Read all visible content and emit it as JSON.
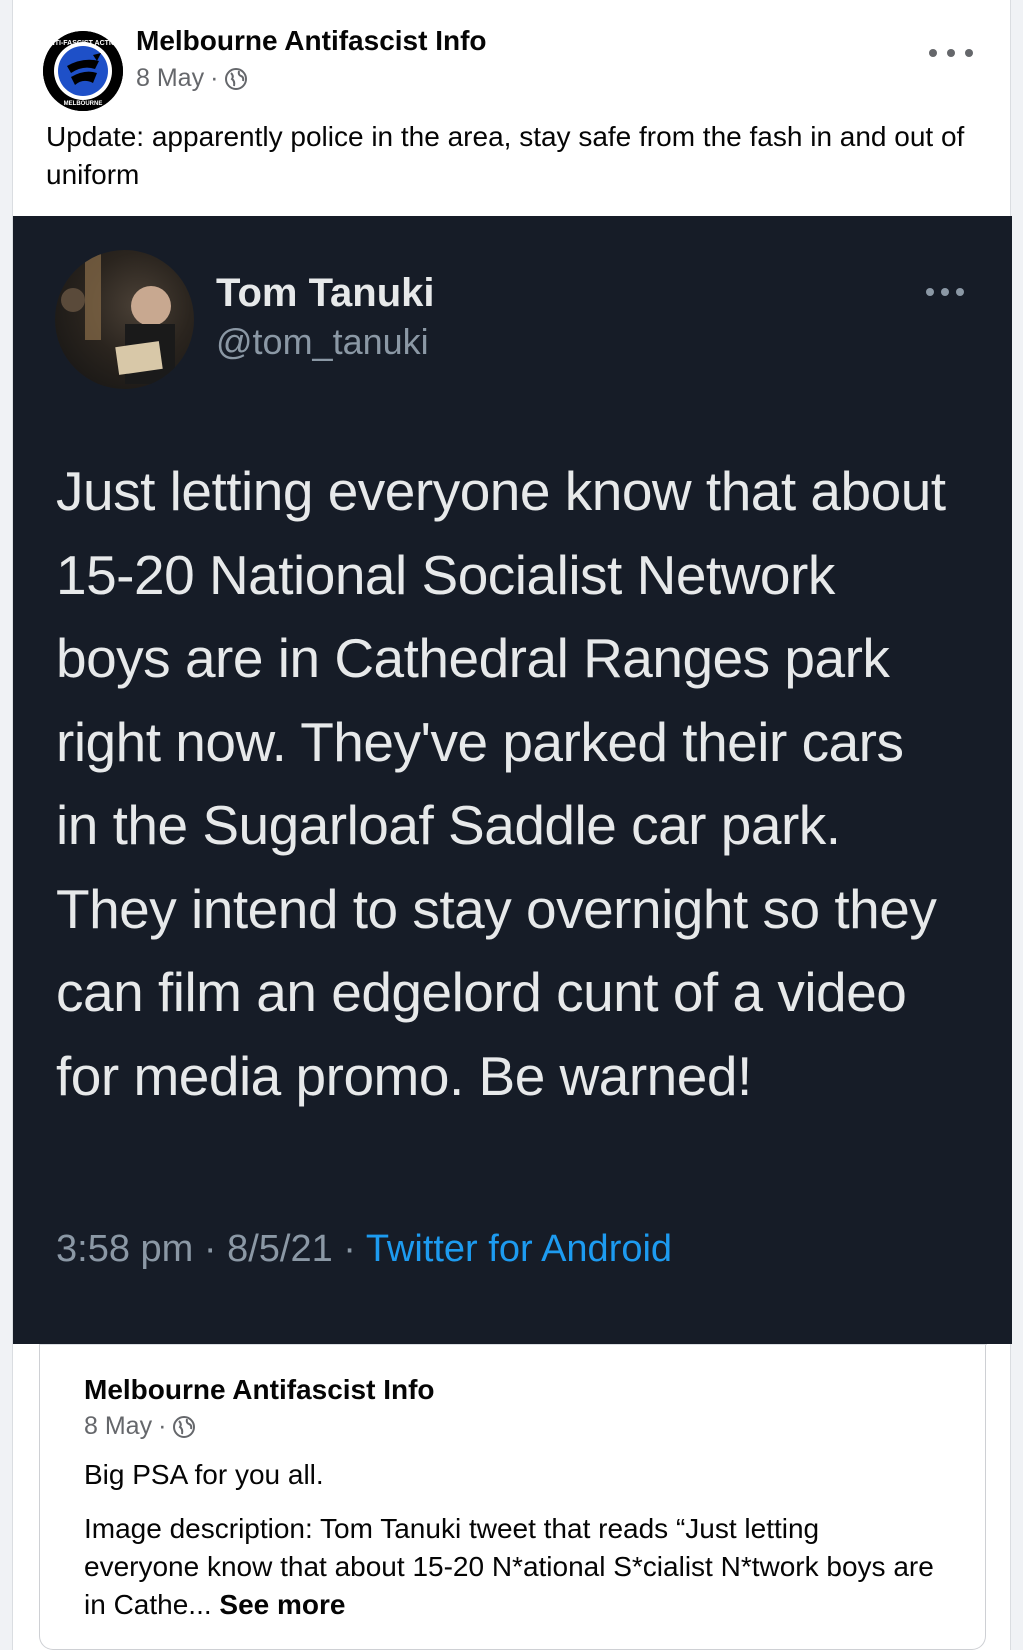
{
  "post": {
    "author": "Melbourne Antifascist Info",
    "date": "8 May",
    "separator": "·",
    "text": "Update: apparently police in the area, stay safe from the fash in and out of uniform",
    "logo_text_top": "ANTI-FASCIST ACTION",
    "logo_text_bottom": "MELBOURNE"
  },
  "tweet": {
    "name": "Tom Tanuki",
    "handle": "@tom_tanuki",
    "body": "Just letting everyone know that about 15-20 National Socialist Network boys are in Cathedral Ranges park right now. They've parked their cars in the Sugarloaf Saddle car park. They intend to stay overnight so they can film an edgelord cunt of a video for media promo. Be warned!",
    "time": "3:58 pm · 8/5/21 · ",
    "source": "Twitter for Android"
  },
  "shared": {
    "author": "Melbourne Antifascist Info",
    "date": "8 May",
    "separator": "·",
    "text1": "Big PSA for you all.",
    "text2": "Image description: Tom Tanuki tweet that reads “Just letting everyone know that about 15-20 N*ational S*cialist N*twork boys are in Cathe... ",
    "see_more": "See more"
  },
  "colors": {
    "tweet_bg": "#161c27",
    "link_blue": "#1d9bf0",
    "antifa_blue": "#1e50c8"
  },
  "icons": [
    "globe-icon",
    "more-options-icon",
    "antifa-logo",
    "user-avatar"
  ]
}
